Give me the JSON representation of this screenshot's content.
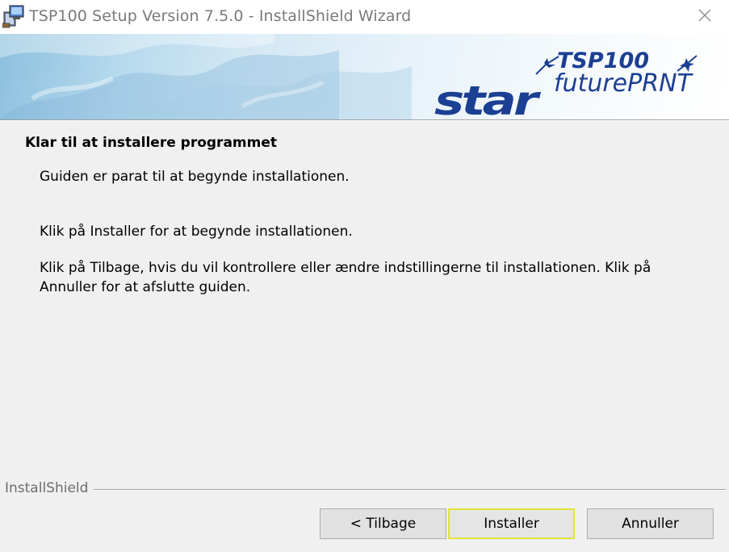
{
  "window": {
    "title": "TSP100 Setup Version 7.5.0 - InstallShield Wizard"
  },
  "banner": {
    "logo_brand": "star",
    "logo_model": "TSP100",
    "logo_product": "futurePRNT",
    "brand_color": "#1b3f93"
  },
  "content": {
    "heading": "Klar til at installere programmet",
    "paragraph1": "Guiden er parat til at begynde installationen.",
    "paragraph2": "Klik på Installer for at begynde installationen.",
    "paragraph3_line1": "Klik på Tilbage, hvis du vil kontrollere eller ændre indstillingerne til installationen. Klik på",
    "paragraph3_line2": "Annuller for at afslutte guiden."
  },
  "footer": {
    "brand_label": "InstallShield",
    "buttons": {
      "back": "< Tilbage",
      "install": "Installer",
      "cancel": "Annuller"
    },
    "focus_color": "#e3e33a"
  },
  "icons": {
    "app": "setup-package-icon",
    "close": "close-icon"
  }
}
